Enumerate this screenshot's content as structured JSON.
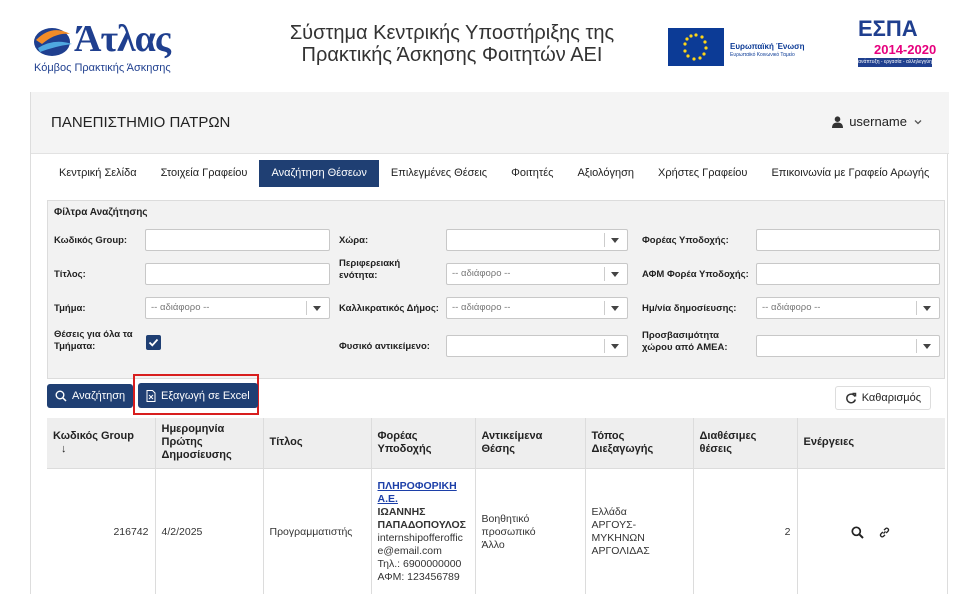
{
  "header": {
    "logo_text": "Άτλας",
    "logo_subtitle": "Κόμβος Πρακτικής Άσκησης",
    "title_line1": "Σύστημα Κεντρικής Υποστήριξης της",
    "title_line2": "Πρακτικής Άσκησης Φοιτητών ΑΕΙ",
    "eu_label": "Ευρωπαϊκή Ένωση",
    "eu_sublabel": "Ευρωπαϊκό Κοινωνικό Ταμείο",
    "espa_label": "ΕΣΠΑ",
    "espa_years": "2014-2020",
    "espa_tagline": "ανάπτυξη - εργασία - αλληλεγγύη"
  },
  "university": {
    "name": "ΠΑΝΕΠΙΣΤΗΜΙΟ ΠΑΤΡΩΝ"
  },
  "user": {
    "name": "username"
  },
  "tabs": [
    {
      "label": "Κεντρική Σελίδα"
    },
    {
      "label": "Στοιχεία Γραφείου"
    },
    {
      "label": "Αναζήτηση Θέσεων",
      "active": true
    },
    {
      "label": "Επιλεγμένες Θέσεις"
    },
    {
      "label": "Φοιτητές"
    },
    {
      "label": "Αξιολόγηση"
    },
    {
      "label": "Χρήστες Γραφείου"
    },
    {
      "label": "Επικοινωνία με Γραφείο Αρωγής"
    }
  ],
  "filters": {
    "title": "Φίλτρα Αναζήτησης",
    "group_code_label": "Κωδικός Group:",
    "country_label": "Χώρα:",
    "host_label": "Φορέας Υποδοχής:",
    "title_label": "Τίτλος:",
    "region_label": "Περιφερειακή ενότητα:",
    "region_value": "-- αδιάφορο --",
    "host_afm_label": "ΑΦΜ Φορέα Υποδοχής:",
    "department_label": "Τμήμα:",
    "department_value": "-- αδιάφορο --",
    "municipality_label": "Καλλικρατικός Δήμος:",
    "municipality_value": "-- αδιάφορο --",
    "pub_date_label": "Ημ/νία δημοσίευσης:",
    "pub_date_value": "-- αδιάφορο --",
    "all_departments_label": "Θέσεις για όλα τα Τμήματα:",
    "physical_object_label": "Φυσικό αντικείμενο:",
    "accessibility_label": "Προσβασιμότητα χώρου από ΑΜΕΑ:"
  },
  "buttons": {
    "search": "Αναζήτηση",
    "export": "Εξαγωγή σε Excel",
    "clear": "Καθαρισμός"
  },
  "table": {
    "headers": {
      "group_code": "Κωδικός Group",
      "first_pub_date": "Ημερομηνία Πρώτης Δημοσίευσης",
      "title": "Τίτλος",
      "host": "Φορέας Υποδοχής",
      "objects": "Αντικείμενα Θέσης",
      "location": "Τόπος Διεξαγωγής",
      "available": "Διαθέσιμες θέσεις",
      "actions": "Ενέργειες"
    },
    "sort_indicator": "↓",
    "rows": [
      {
        "group_code": "216742",
        "date": "4/2/2025",
        "title": "Προγραμματιστής",
        "host_name": "ΠΛΗΡΟΦΟΡΙΚΗ Α.Ε.",
        "host_person": "ΙΩΑΝΝΗΣ ΠΑΠΑΔΟΠΟΥΛΟΣ",
        "host_email": "internshipofferoffice@email.com",
        "host_phone": "Τηλ.: 6900000000",
        "host_afm": "ΑΦΜ: 123456789",
        "object1": "Βοηθητικό προσωπικό",
        "object2": "Άλλο",
        "location1": "Ελλάδα",
        "location2": "ΑΡΓΟΥΣ-ΜΥΚΗΝΩΝ",
        "location3": "ΑΡΓΟΛΙΔΑΣ",
        "available": "2"
      }
    ]
  }
}
